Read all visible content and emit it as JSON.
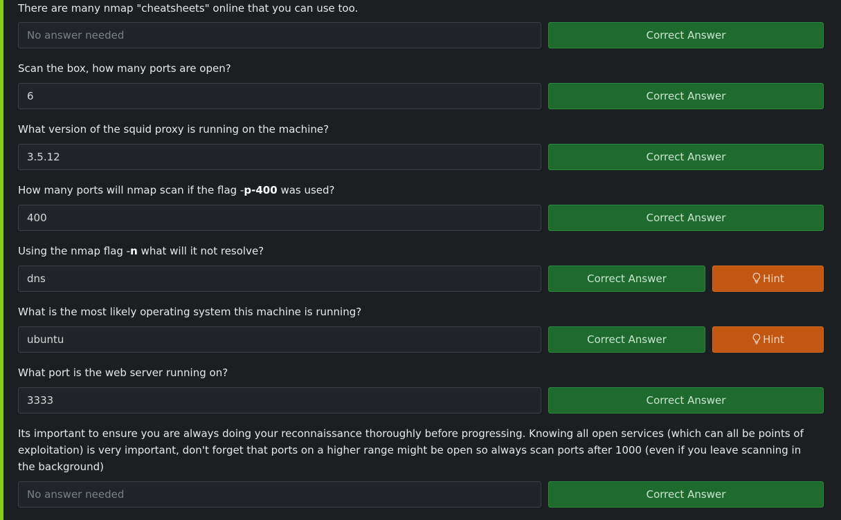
{
  "questions": [
    {
      "text": "There are many nmap \"cheatsheets\" online that you can use too.",
      "answer": "",
      "placeholder": "No answer needed",
      "correct_label": "Correct Answer"
    },
    {
      "text": "Scan the box, how many ports are open?",
      "answer": "6",
      "placeholder": "",
      "correct_label": "Correct Answer"
    },
    {
      "text": "What version of the squid proxy is running on the machine?",
      "answer": "3.5.12",
      "placeholder": "",
      "correct_label": "Correct Answer"
    },
    {
      "text_before": "How many ports will nmap scan if the flag -",
      "text_bold": "p-400",
      "text_after": " was used?",
      "answer": "400",
      "placeholder": "",
      "correct_label": "Correct Answer"
    },
    {
      "text_before": "Using the nmap flag -",
      "text_bold": "n",
      "text_after": " what will it not resolve?",
      "answer": "dns",
      "placeholder": "",
      "correct_label": "Correct Answer",
      "hint_label": "Hint"
    },
    {
      "text": "What is the most likely operating system this machine is running?",
      "answer": "ubuntu",
      "placeholder": "",
      "correct_label": "Correct Answer",
      "hint_label": "Hint"
    },
    {
      "text": "What port is the web server running on?",
      "answer": "3333",
      "placeholder": "",
      "correct_label": "Correct Answer"
    },
    {
      "text": "Its important to ensure you are always doing your reconnaissance thoroughly before progressing. Knowing all open services (which can all be points of exploitation) is very important, don't forget that ports on a higher range might be open so always scan ports after 1000 (even if you leave scanning in the background)",
      "answer": "",
      "placeholder": "No answer needed",
      "correct_label": "Correct Answer"
    }
  ],
  "icons": {
    "hint": "lightbulb-icon"
  },
  "colors": {
    "accent": "#88cc14",
    "correct": "#1f6b2e",
    "hint": "#c25712"
  }
}
